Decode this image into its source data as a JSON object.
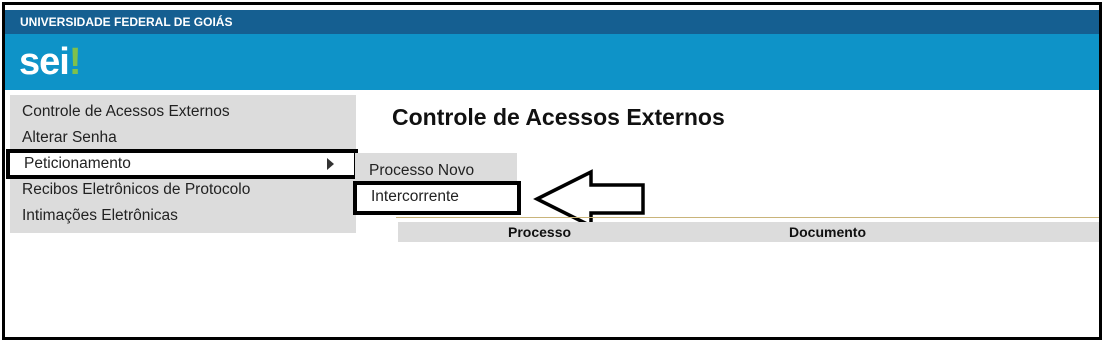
{
  "header": {
    "org_name": "UNIVERSIDADE FEDERAL DE GOIÁS",
    "logo_text": "sei",
    "logo_mark": "!",
    "colors": {
      "org_bar": "#155f91",
      "brand_bar": "#0e93c8",
      "logo_accent": "#7fc04b"
    }
  },
  "menu": {
    "items": [
      {
        "label": "Controle de Acessos Externos"
      },
      {
        "label": "Alterar Senha"
      },
      {
        "label": "Peticionamento"
      },
      {
        "label": "Recibos Eletrônicos de Protocolo"
      },
      {
        "label": "Intimações Eletrônicas"
      }
    ],
    "submenu": [
      {
        "label": "Processo Novo"
      },
      {
        "label": "Intercorrente"
      }
    ]
  },
  "main": {
    "title": "Controle de Acessos Externos",
    "table": {
      "columns": [
        "Processo",
        "Documento"
      ]
    }
  },
  "icons": {
    "submenu_caret": "caret-right-icon",
    "pointer_arrow": "left-arrow-icon"
  }
}
